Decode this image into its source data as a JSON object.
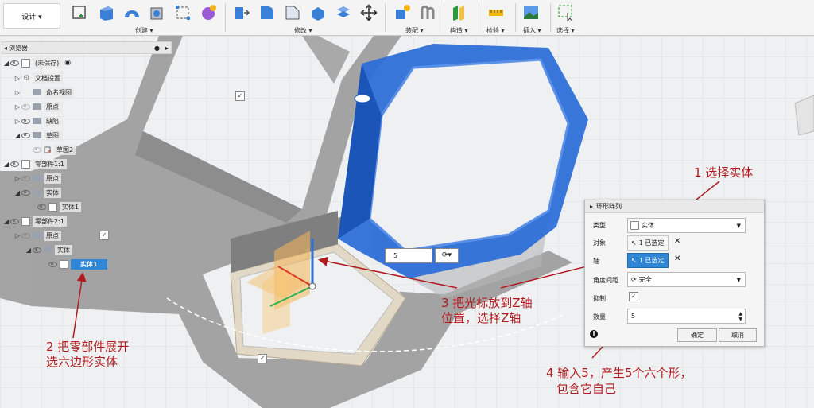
{
  "toolbar": {
    "workspace": "设计 ▾",
    "groups": [
      {
        "label": "创建 ▾"
      },
      {
        "label": "修改 ▾"
      },
      {
        "label": "装配 ▾"
      },
      {
        "label": "构造 ▾"
      },
      {
        "label": "检验 ▾"
      },
      {
        "label": "插入 ▾"
      },
      {
        "label": "选择 ▾"
      }
    ]
  },
  "browser": {
    "title": "浏览器",
    "items": [
      {
        "label": "(未保存)"
      },
      {
        "label": "文档设置"
      },
      {
        "label": "命名视图"
      },
      {
        "label": "原点"
      },
      {
        "label": "缺陷"
      },
      {
        "label": "草图"
      },
      {
        "label": "草图2"
      },
      {
        "label": "零部件1:1"
      },
      {
        "label": "原点"
      },
      {
        "label": "实体"
      },
      {
        "label": "实体1"
      },
      {
        "label": "零部件2:1"
      },
      {
        "label": "原点"
      },
      {
        "label": "实体"
      },
      {
        "label": "实体1"
      }
    ]
  },
  "viewport": {
    "count_value": "5"
  },
  "dialog": {
    "title": "环形阵列",
    "type_label": "类型",
    "type_value": "实体",
    "objects_label": "对象",
    "objects_value": "1 已选定",
    "axis_label": "轴",
    "axis_value": "1 已选定",
    "angle_label": "角度间距",
    "angle_value": "完全",
    "suppress_label": "抑制",
    "count_label": "数量",
    "count_value": "5",
    "ok": "确定",
    "cancel": "取消"
  },
  "annotations": {
    "a1": "1 选择实体",
    "a2_line1": "2 把零部件展开",
    "a2_line2": "选六边形实体",
    "a3_line1": "3 把光标放到Z轴",
    "a3_line2": "位置，选择Z轴",
    "a4_line1": "4 输入5，产生5个六个形，",
    "a4_line2": "包含它自己"
  },
  "colors": {
    "selected_body": "#2e6fd8",
    "annotation": "#b01a1f",
    "highlight_row": "#2e86d4"
  }
}
